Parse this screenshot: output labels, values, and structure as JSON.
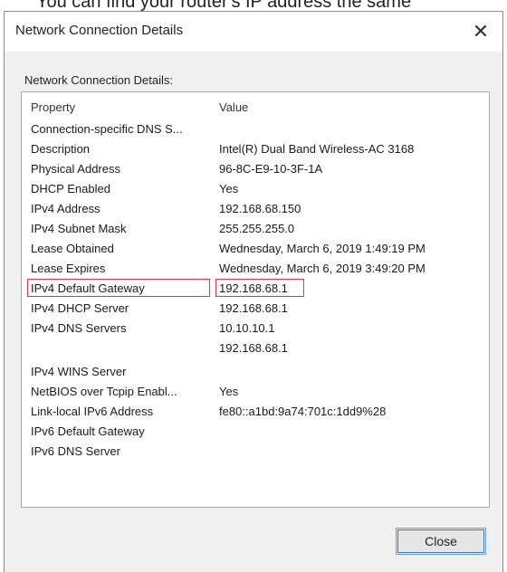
{
  "background_snippet": "You can find your router's IP address the same",
  "dialog": {
    "title": "Network Connection Details",
    "close_glyph": "✕",
    "group_label": "Network Connection Details:",
    "close_button_label": "Close"
  },
  "table": {
    "headers": {
      "property": "Property",
      "value": "Value"
    },
    "rows": [
      {
        "property": "Connection-specific DNS S...",
        "value": ""
      },
      {
        "property": "Description",
        "value": "Intel(R) Dual Band Wireless-AC 3168"
      },
      {
        "property": "Physical Address",
        "value": "96-8C-E9-10-3F-1A"
      },
      {
        "property": "DHCP Enabled",
        "value": "Yes"
      },
      {
        "property": "IPv4 Address",
        "value": "192.168.68.150"
      },
      {
        "property": "IPv4 Subnet Mask",
        "value": "255.255.255.0"
      },
      {
        "property": "Lease Obtained",
        "value": "Wednesday, March 6, 2019 1:49:19 PM"
      },
      {
        "property": "Lease Expires",
        "value": "Wednesday, March 6, 2019 3:49:20 PM"
      },
      {
        "property": "IPv4 Default Gateway",
        "value": "192.168.68.1"
      },
      {
        "property": "IPv4 DHCP Server",
        "value": "192.168.68.1"
      },
      {
        "property": "IPv4 DNS Servers",
        "value": "10.10.10.1"
      },
      {
        "property": "",
        "value": "192.168.68.1"
      },
      {
        "property": "IPv4 WINS Server",
        "value": ""
      },
      {
        "property": "NetBIOS over Tcpip Enabl...",
        "value": "Yes"
      },
      {
        "property": "Link-local IPv6 Address",
        "value": "fe80::a1bd:9a74:701c:1dd9%28"
      },
      {
        "property": "IPv6 Default Gateway",
        "value": ""
      },
      {
        "property": "IPv6 DNS Server",
        "value": ""
      }
    ]
  },
  "highlight_color": "#d9384d"
}
